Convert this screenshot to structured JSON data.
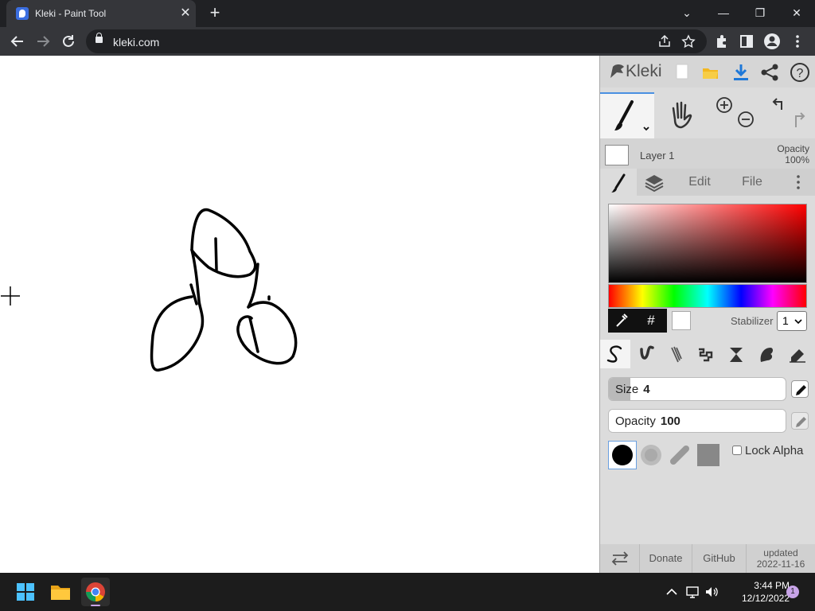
{
  "browser": {
    "tab_title": "Kleki - Paint Tool",
    "tab_close": "✕",
    "new_tab": "+",
    "url": "kleki.com",
    "window_controls": {
      "list": "⌄",
      "minimize": "—",
      "restore": "❐",
      "close": "✕"
    }
  },
  "app": {
    "logo_text": "Kleki",
    "layer": {
      "name": "Layer 1",
      "opacity_label": "Opacity",
      "opacity_value": "100%"
    },
    "tabs": {
      "edit": "Edit",
      "file": "File"
    },
    "color": {
      "hash": "#",
      "stabilizer_label": "Stabilizer",
      "stabilizer_value": "1"
    },
    "size": {
      "label": "Size",
      "value": "4",
      "fraction": 0.12
    },
    "opacity": {
      "label": "Opacity",
      "value": "100",
      "fraction": 1.0
    },
    "lock_alpha": "Lock Alpha",
    "footer": {
      "donate": "Donate",
      "github": "GitHub",
      "updated_label": "updated",
      "updated_date": "2022-11-16"
    },
    "colors": {
      "primary": "#000000",
      "secondary": "#ffffff"
    }
  },
  "taskbar": {
    "time": "3:44 PM",
    "date": "12/12/2022",
    "notification_count": "1"
  }
}
